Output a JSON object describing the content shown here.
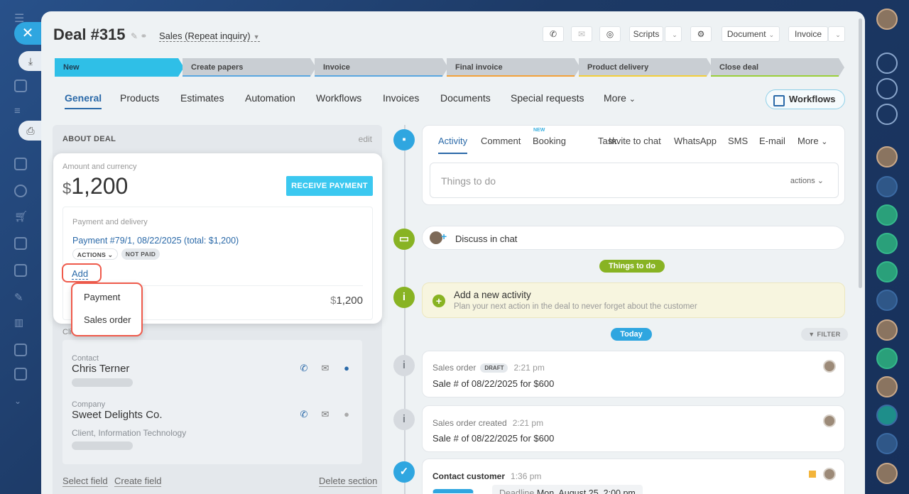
{
  "deal": {
    "title": "Deal #315",
    "pipeline": "Sales (Repeat inquiry)"
  },
  "header_buttons": {
    "scripts": "Scripts",
    "document": "Document",
    "invoice": "Invoice"
  },
  "stages": [
    {
      "label": "New",
      "color": "#2fbfe7"
    },
    {
      "label": "Create papers",
      "color": "#5aa7e0"
    },
    {
      "label": "Invoice",
      "color": "#5aa7e0"
    },
    {
      "label": "Final invoice",
      "color": "#f3a23a"
    },
    {
      "label": "Product delivery",
      "color": "#f3cf3a"
    },
    {
      "label": "Close deal",
      "color": "#9bd03a"
    }
  ],
  "tabs": [
    "General",
    "Products",
    "Estimates",
    "Automation",
    "Workflows",
    "Invoices",
    "Documents",
    "Special requests",
    "More"
  ],
  "workflows_button": "Workflows",
  "about": {
    "heading": "ABOUT DEAL",
    "edit": "edit",
    "amount_label": "Amount and currency",
    "currency_symbol": "$",
    "amount": "1,200",
    "receive_payment": "RECEIVE PAYMENT",
    "payment_delivery_label": "Payment and delivery",
    "payment_link": "Payment #79/1, 08/22/2025 (total: $1,200)",
    "actions_pill": "ACTIONS",
    "not_paid_pill": "NOT PAID",
    "add_link": "Add",
    "total_currency": "$",
    "total_amount": "1,200",
    "add_menu": [
      "Payment",
      "Sales order"
    ],
    "client_label": "Cli",
    "contact_label": "Contact",
    "contact_name": "Chris Terner",
    "company_label": "Company",
    "company_name": "Sweet Delights Co.",
    "company_tags": "Client, Information Technology",
    "select_field": "Select field",
    "create_field": "Create field",
    "delete_section": "Delete section"
  },
  "activity": {
    "tabs": [
      "Activity",
      "Comment",
      "Booking",
      "Task",
      "Invite to chat",
      "WhatsApp",
      "SMS",
      "E-mail",
      "More"
    ],
    "new_badge": "NEW",
    "todo_placeholder": "Things to do",
    "todo_actions": "actions",
    "discuss": "Discuss in chat",
    "things_chip": "Things to do",
    "add_activity_title": "Add a new activity",
    "add_activity_sub": "Plan your next action in the deal to never forget about the customer",
    "today_chip": "Today",
    "filter": "FILTER",
    "items": [
      {
        "title": "Sales order",
        "badge": "DRAFT",
        "time": "2:21 pm",
        "body": "Sale # of 08/22/2025 for $600"
      },
      {
        "title": "Sales order created",
        "time": "2:21 pm",
        "body": "Sale # of 08/22/2025 for $600"
      }
    ],
    "contact_customer": {
      "title": "Contact customer",
      "time": "1:36 pm",
      "deadline_label": "Deadline",
      "deadline": "Mon, August 25, 2:00 pm"
    }
  }
}
